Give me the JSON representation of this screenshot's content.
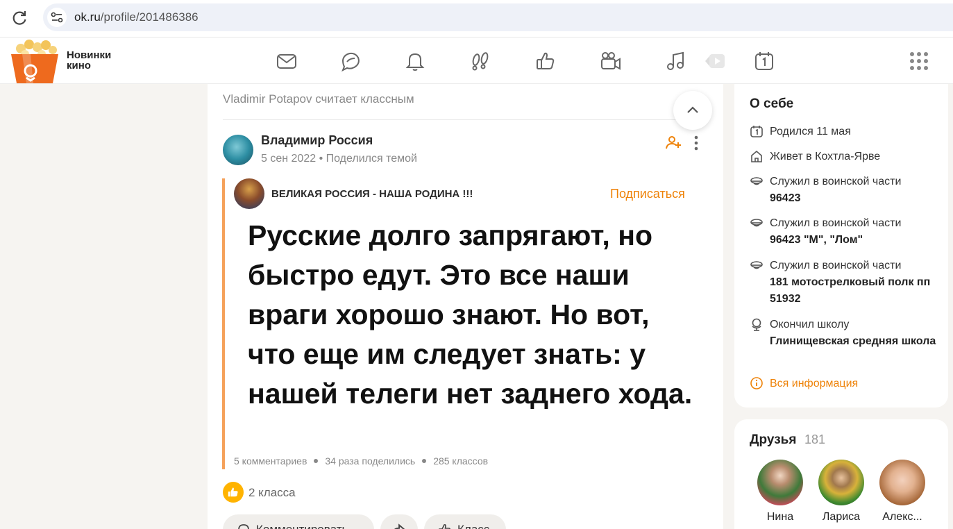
{
  "browser": {
    "url_host": "ok.ru",
    "url_path": "/profile/201486386"
  },
  "header": {
    "promo_line1": "Новинки",
    "promo_line2": "кино",
    "nav_icons": [
      "messages-icon",
      "discussions-icon",
      "notifications-icon",
      "guests-icon",
      "events-icon",
      "video-icon",
      "music-icon",
      "media-icon",
      "calendar-icon"
    ],
    "accent": "#ee8208"
  },
  "feed": {
    "liker_text": "Vladimir Potapov считает классным",
    "author_name": "Владимир Россия",
    "author_date": "5 сен 2022",
    "author_action": "Поделился темой",
    "group_name": "ВЕЛИКАЯ РОССИЯ - НАША РОДИНА !!!",
    "subscribe_label": "Подписаться",
    "quote_text": "Русские долго запрягают, но быстро едут. Это все наши враги хорошо знают. Но вот, что еще им следует знать: у нашей телеги нет заднего хода.",
    "stat_comments": "5 комментариев",
    "stat_shares": "34 раза поделились",
    "stat_likes": "285 классов",
    "like_count": "2 класса",
    "btn_comment": "Комментировать",
    "btn_like": "Класс"
  },
  "about": {
    "title": "О себе",
    "birthday": "Родился 11 мая",
    "lives": "Живет в Кохтла-Ярве",
    "served1_label": "Служил в воинской части",
    "served1_value": "96423",
    "served2_label": "Служил в воинской части",
    "served2_value": "96423 \"М\", \"Лом\"",
    "served3_label": "Служил в воинской части",
    "served3_value": "181 мотострелковый полк пп 51932",
    "school_label": "Окончил школу",
    "school_value": "Глинищевская средняя школа",
    "all_info": "Вся информация"
  },
  "friends": {
    "title": "Друзья",
    "count": "181",
    "items": [
      {
        "name": "Нина"
      },
      {
        "name": "Лариса"
      },
      {
        "name": "Алекс..."
      }
    ]
  }
}
